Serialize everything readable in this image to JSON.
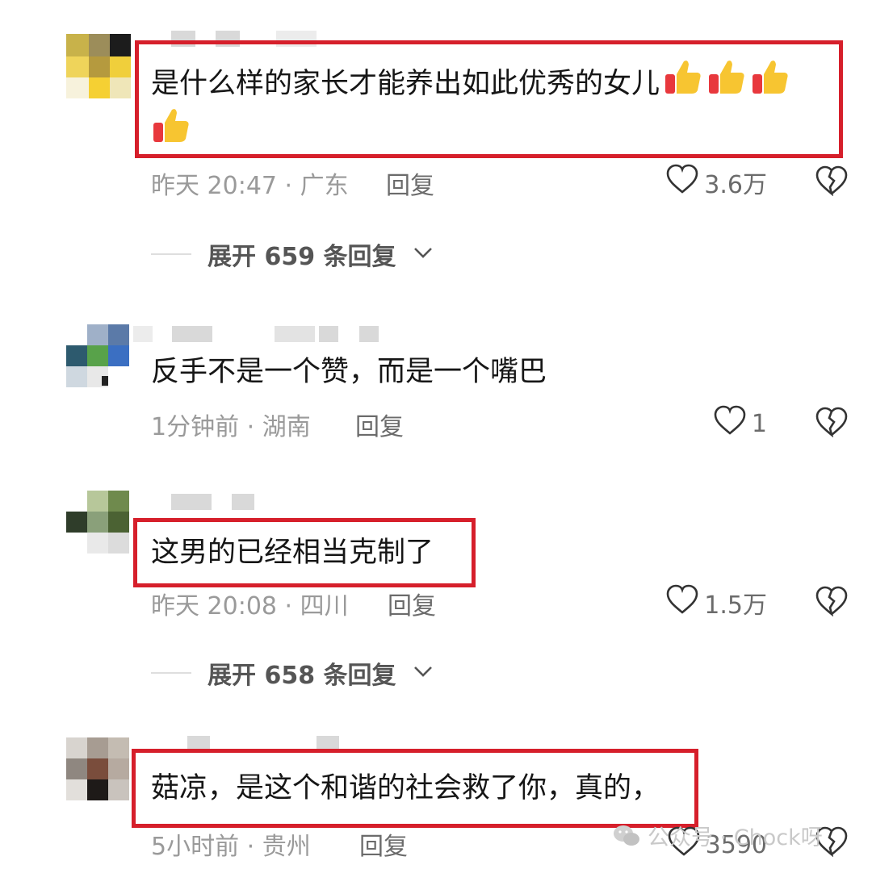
{
  "comments": [
    {
      "text": "是什么样的家长才能养出如此优秀的女儿",
      "time": "昨天 20:47",
      "location": "广东",
      "reply_label": "回复",
      "likes": "3.6万",
      "expand_label": "展开 659 条回复",
      "emoji_count": 4,
      "highlighted": true
    },
    {
      "text": "反手不是一个赞，而是一个嘴巴",
      "time": "1分钟前",
      "location": "湖南",
      "reply_label": "回复",
      "likes": "1",
      "highlighted": false
    },
    {
      "text": "这男的已经相当克制了",
      "time": "昨天 20:08",
      "location": "四川",
      "reply_label": "回复",
      "likes": "1.5万",
      "expand_label": "展开 658 条回复",
      "highlighted": true
    },
    {
      "text": "菇凉，是这个和谐的社会救了你，真的，",
      "time": "5小时前",
      "location": "贵州",
      "reply_label": "回复",
      "likes": "3590",
      "highlighted": true
    }
  ],
  "separator": " · ",
  "watermark": {
    "text": "公众号 · Chock呀",
    "icon": "wechat-icon"
  },
  "colors": {
    "highlight_border": "#d61f2b",
    "meta_text": "#9a9a9a",
    "body_text": "#161616"
  }
}
